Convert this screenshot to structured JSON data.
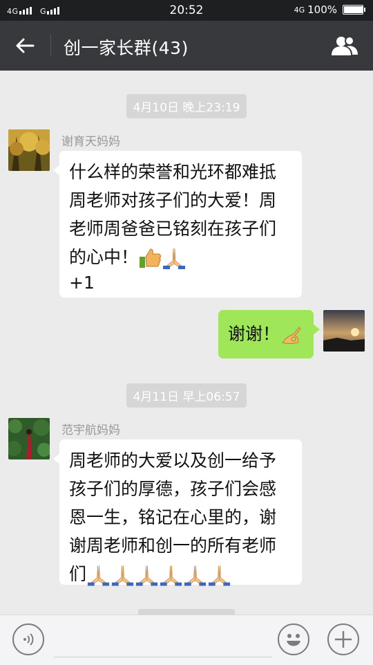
{
  "status_bar": {
    "left_signal": "4G▎▎▎▎ G▎▎▎▎",
    "time": "20:52",
    "network": "4G",
    "battery": "100%",
    "battery_level": 1.0
  },
  "header": {
    "back_icon": "back-arrow-icon",
    "title": "创一家长群(43)",
    "group_icon": "group-members-icon"
  },
  "messages": [
    {
      "type": "timestamp",
      "text": "4月10日 晚上23:19"
    },
    {
      "type": "incoming",
      "sender": "谢育天妈妈",
      "lines": [
        "什么样的荣誉和光环都难抵",
        "周老师对孩子们的大爱！周",
        "老师周爸爸已铭刻在孩子们",
        "的心中！",
        "+1"
      ],
      "emojis": [
        "thumbs-up-icon",
        "praying-hands-icon"
      ]
    },
    {
      "type": "outgoing",
      "text": "谢谢！",
      "emojis": [
        "ok-hand-icon"
      ]
    },
    {
      "type": "timestamp",
      "text": "4月11日 早上06:57"
    },
    {
      "type": "incoming",
      "sender": "范宇航妈妈",
      "lines": [
        "周老师的大爱以及创一给予",
        "孩子们的厚德，孩子们会感",
        "恩一生，铭记在心里的，谢",
        "谢周老师和创一的所有老师",
        "们"
      ],
      "emojis": [
        "praying-hands-icon",
        "praying-hands-icon",
        "praying-hands-icon",
        "praying-hands-icon",
        "praying-hands-icon",
        "praying-hands-icon"
      ]
    }
  ],
  "input_bar": {
    "voice_icon": "voice-input-icon",
    "text_value": "",
    "emoji_icon": "smiley-icon",
    "more_icon": "plus-icon"
  },
  "colors": {
    "status_bar_bg": "#1e1f21",
    "title_bar_bg": "#38393d",
    "chat_bg": "#ebebeb",
    "outgoing_bubble": "#9fe658",
    "incoming_bubble": "#ffffff"
  }
}
